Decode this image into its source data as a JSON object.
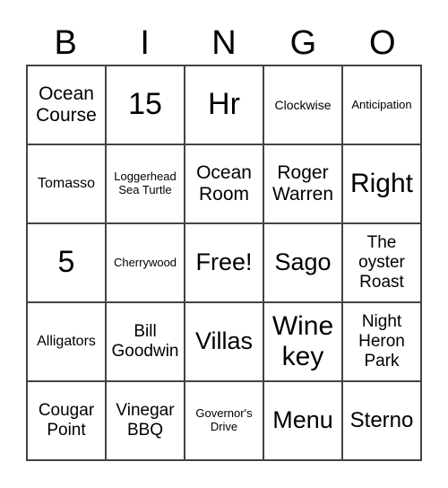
{
  "header": {
    "letters": [
      "B",
      "I",
      "N",
      "G",
      "O"
    ]
  },
  "rows": [
    [
      "Ocean Course",
      "15",
      "Hr",
      "Clockwise",
      "Anticipation"
    ],
    [
      "Tomasso",
      "Loggerhead Sea Turtle",
      "Ocean Room",
      "Roger Warren",
      "Right"
    ],
    [
      "5",
      "Cherrywood",
      "Free!",
      "Sago",
      "The oyster Roast"
    ],
    [
      "Alligators",
      "Bill Goodwin",
      "Villas",
      "Wine key",
      "Night Heron Park"
    ],
    [
      "Cougar Point",
      "Vinegar BBQ",
      "Governor's Drive",
      "Menu",
      "Sterno"
    ]
  ]
}
